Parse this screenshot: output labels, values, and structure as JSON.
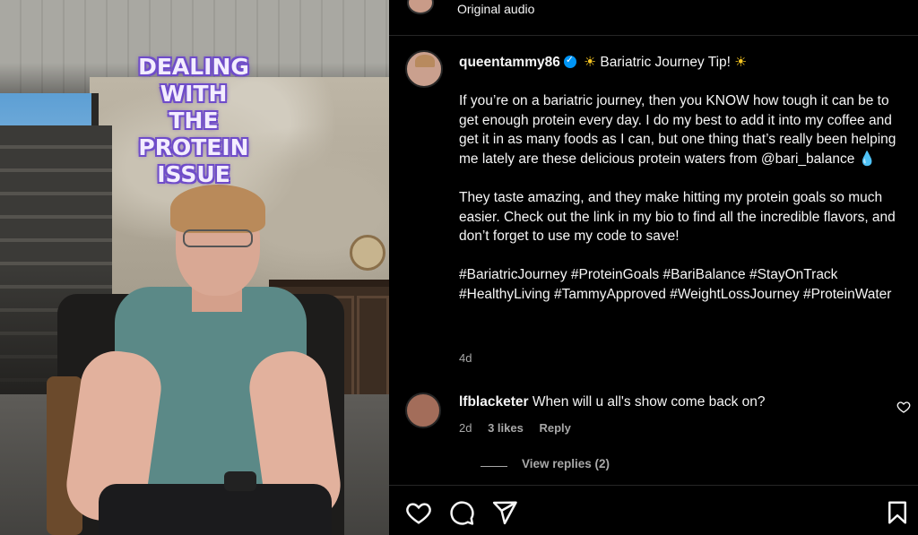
{
  "video": {
    "overlay_lines": [
      "DEALING",
      "WITH",
      "THE",
      "PROTEIN",
      "ISSUE"
    ]
  },
  "audio": {
    "label": "Original audio"
  },
  "post": {
    "username": "queentammy86",
    "title": "Bariatric Journey Tip!",
    "sun_icon": "☀",
    "paragraph1": "If you’re on a bariatric journey, then you KNOW how tough it can be to get enough protein every day. I do my best to add it into my coffee and get it in as many foods as I can, but one thing that’s really been helping me lately are these delicious protein waters from @bari_balance",
    "drop_icon": "💧",
    "paragraph2": "They taste amazing, and they make hitting my protein goals so much easier. Check out the link in my bio to find all the incredible flavors, and don’t forget to use my code to save!",
    "hashtags": "#BariatricJourney #ProteinGoals #BariBalance #StayOnTrack #HealthyLiving #TammyApproved #WeightLossJourney #ProteinWater",
    "time": "4d"
  },
  "comment": {
    "username": "lfblacketer",
    "text": "When will u all's show come back on?",
    "time": "2d",
    "likes": "3 likes",
    "reply": "Reply",
    "view_replies": "View replies (2)"
  },
  "icons": {
    "like": "heart-icon",
    "comment": "comment-icon",
    "share": "send-icon",
    "save": "bookmark-icon",
    "verified": "verified-badge-icon"
  },
  "colors": {
    "background": "#000000",
    "text": "#f5f5f5",
    "muted": "#a8a8a8",
    "verified": "#0095f6",
    "overlay_text_stroke": "#6f4cc9"
  }
}
